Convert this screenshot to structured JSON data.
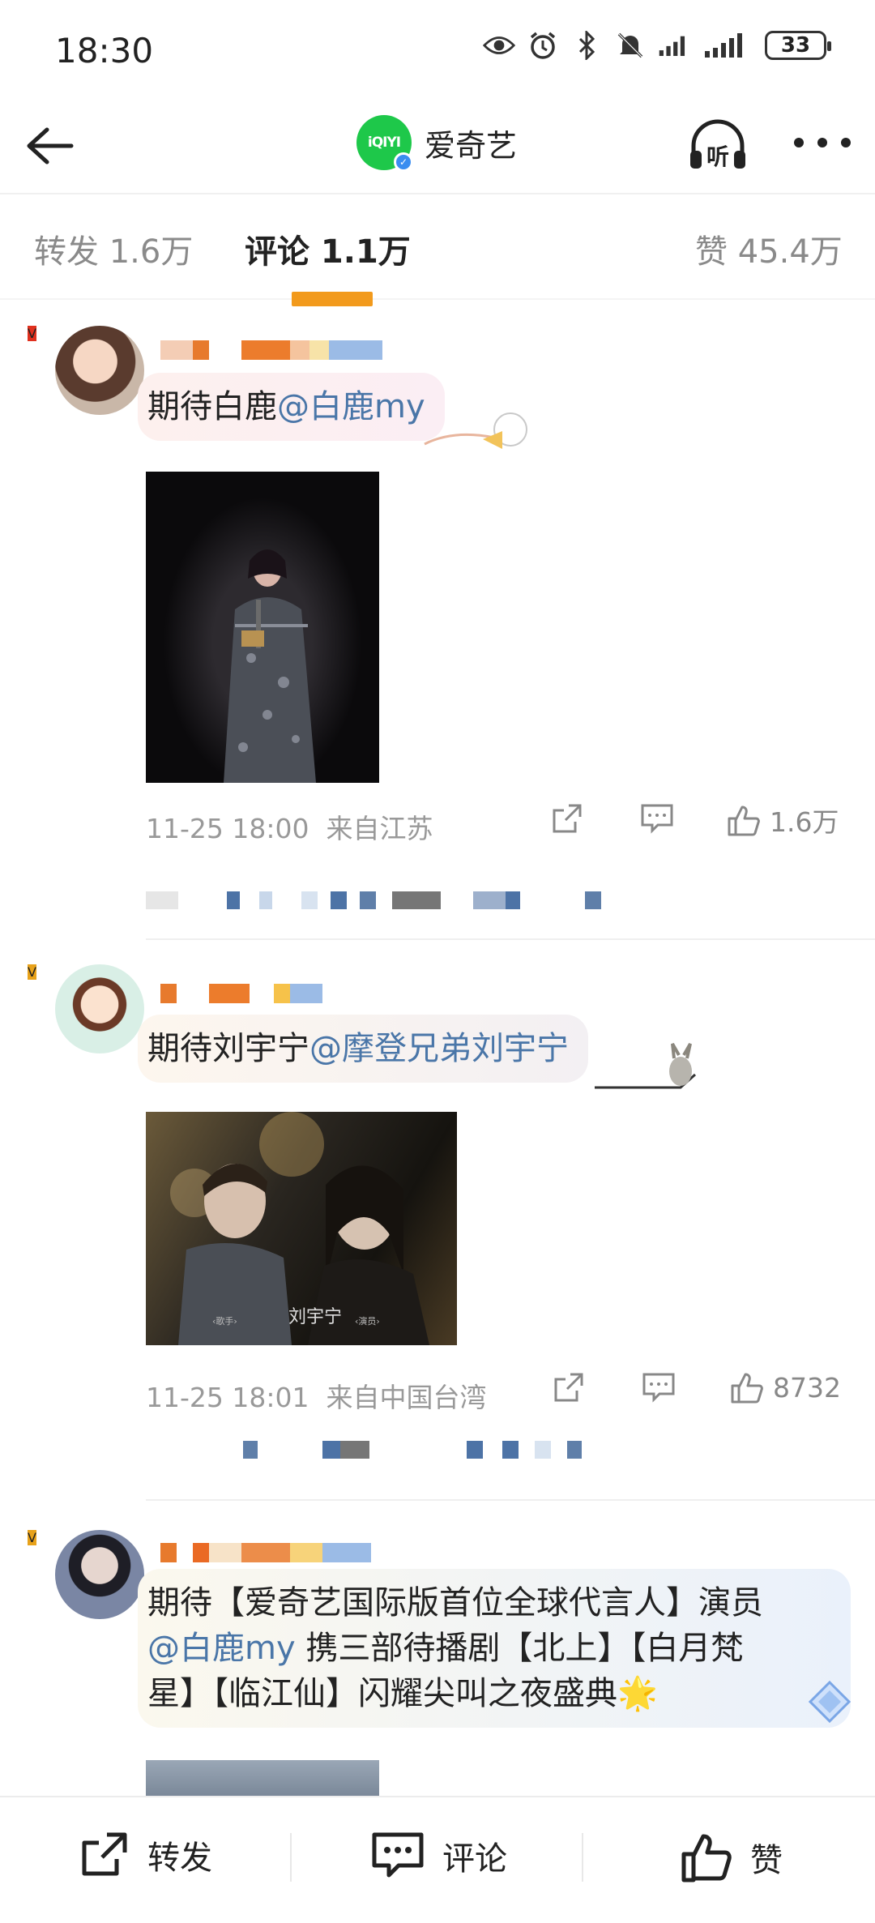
{
  "status_bar": {
    "time": "18:30",
    "battery": "33",
    "icons": [
      "eye-icon",
      "alarm-icon",
      "bluetooth-icon",
      "mute-icon",
      "signal-icon",
      "signal-icon-2"
    ]
  },
  "nav": {
    "logo_text": "iQIYI",
    "title": "爱奇艺",
    "listen_label": "听"
  },
  "tabs": {
    "repost": "转发 1.6万",
    "comment": "评论 1.1万",
    "like": "赞 45.4万",
    "accent_color": "#f29a1c"
  },
  "comments": [
    {
      "text_prefix": "期待白鹿",
      "mention": "@白鹿my",
      "time": "11-25 18:00",
      "location": "来自江苏",
      "likes": "1.6万"
    },
    {
      "text_prefix": "期待刘宇宁",
      "mention": "@摩登兄弟刘宇宁",
      "time": "11-25 18:01",
      "location": "来自中国台湾",
      "likes": "8732",
      "image_caption_left": "‹歌手›",
      "image_caption_name": "刘宇宁",
      "image_caption_right": "‹演员›"
    },
    {
      "text_line1": "期待【爱奇艺国际版首位全球代言人】演员",
      "mention": "@白鹿my",
      "text_line2_rest": " 携三部待播剧【北上】【白月梵",
      "text_line3": "星】【临江仙】闪耀尖叫之夜盛典",
      "emoji": "🌟"
    }
  ],
  "bottom_bar": {
    "repost": "转发",
    "comment": "评论",
    "like": "赞"
  },
  "colors": {
    "mention": "#4a76a8",
    "verified_badge_orange": "#e8a21a",
    "verified_badge_red": "#e0301e"
  }
}
